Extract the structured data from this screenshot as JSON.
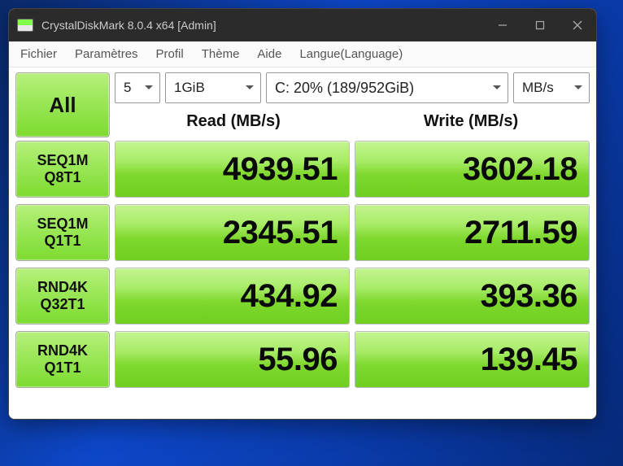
{
  "window": {
    "title": "CrystalDiskMark 8.0.4 x64 [Admin]"
  },
  "menu": {
    "file": "Fichier",
    "settings": "Paramètres",
    "profile": "Profil",
    "theme": "Thème",
    "help": "Aide",
    "language": "Langue(Language)"
  },
  "controls": {
    "all": "All",
    "count": "5",
    "size": "1GiB",
    "drive": "C: 20% (189/952GiB)",
    "unit": "MB/s"
  },
  "headers": {
    "read": "Read (MB/s)",
    "write": "Write (MB/s)"
  },
  "tests": [
    {
      "line1": "SEQ1M",
      "line2": "Q8T1",
      "read": "4939.51",
      "write": "3602.18"
    },
    {
      "line1": "SEQ1M",
      "line2": "Q1T1",
      "read": "2345.51",
      "write": "2711.59"
    },
    {
      "line1": "RND4K",
      "line2": "Q32T1",
      "read": "434.92",
      "write": "393.36"
    },
    {
      "line1": "RND4K",
      "line2": "Q1T1",
      "read": "55.96",
      "write": "139.45"
    }
  ]
}
